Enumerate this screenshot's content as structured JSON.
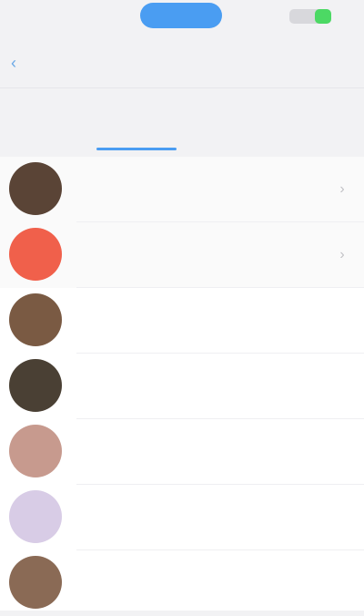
{
  "status_bar": {
    "time": "",
    "battery_percent": 40
  },
  "nav": {
    "back_label": "",
    "title": "",
    "action_label": ""
  },
  "tabs": [
    {
      "label": "",
      "active": true
    },
    {
      "label": "",
      "active": false
    },
    {
      "label": "",
      "active": false
    }
  ],
  "contacts": [
    {
      "name": "",
      "sub": "",
      "tag": "",
      "avatar_color": "#5a4436"
    },
    {
      "name": "",
      "sub": "",
      "tag": "",
      "avatar_color": "#f0604b"
    },
    {
      "name": "",
      "sub": "",
      "tag": "",
      "avatar_color": "#7a5a43"
    },
    {
      "name": "",
      "sub": "",
      "tag": "",
      "avatar_color": "#4a4034"
    },
    {
      "name": "",
      "sub": "",
      "tag": "",
      "avatar_color": "#c79a8e"
    },
    {
      "name": "",
      "sub": "",
      "tag": "",
      "avatar_color": "#d8cce6"
    },
    {
      "name": "",
      "sub": "",
      "tag": "",
      "avatar_color": "#8a6a55"
    }
  ],
  "colors": {
    "accent": "#4a9df2",
    "badge": "#f06262",
    "background": "#f2f2f4"
  }
}
